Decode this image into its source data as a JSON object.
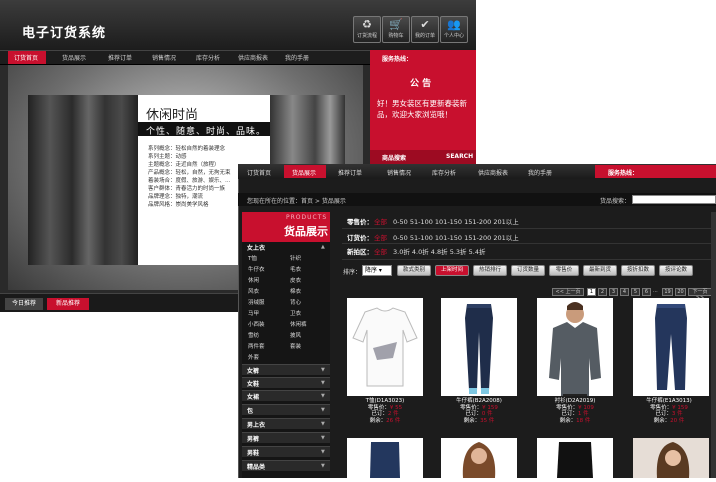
{
  "back": {
    "title": "电子订货系统",
    "top_icons": [
      {
        "icon": "recycle-icon",
        "label": "订货流程",
        "glyph": "♻"
      },
      {
        "icon": "cart-icon",
        "label": "购物车",
        "glyph": "🛒"
      },
      {
        "icon": "check-icon",
        "label": "我的订单",
        "glyph": "✔"
      },
      {
        "icon": "users-icon",
        "label": "个人中心",
        "glyph": "👥"
      }
    ],
    "nav": [
      "订货首页",
      "货品展示",
      "推荐订单",
      "销售情况",
      "库存分析",
      "供应商报表",
      "我的手册"
    ],
    "banner": {
      "heading": "休闲时尚",
      "tagline": "个性、随意、时尚、品味。",
      "specs": [
        "系列概念：轻松自然的着装理念",
        "系列主题：动感",
        "主题概念：走近自然（旅程）",
        "产品概念：轻松，自然，无拘无束",
        "着装场合：度假、旅游、娱乐、…",
        "客户群体：青春活力的时尚一族",
        "品牌理念：独特，潮流",
        "品牌风格：崇尚美学风格"
      ]
    },
    "notice": {
      "hotline": "服务热线：",
      "title": "公 告",
      "body": "好！男女装区有更新春装新品，欢迎大家浏览哦！",
      "bottom_left": "商品搜索",
      "bottom_right": "SEARCH"
    },
    "footer_tabs": [
      "今日推荐",
      "新品推荐"
    ]
  },
  "front": {
    "nav": [
      "订货首页",
      "货品展示",
      "推荐订单",
      "销售情况",
      "库存分析",
      "供应商报表",
      "我的手册"
    ],
    "hotline": "服务热线：",
    "breadcrumb": "您现在所在的位置：首页 > 货品展示",
    "search_label": "货品搜索：",
    "sidebar": {
      "title_en": "PRODUCTS",
      "title_cn": "货品展示",
      "women": "女上衣",
      "women_subs": [
        "T恤",
        "针织",
        "牛仔衣",
        "毛衣",
        "休闲",
        "皮衣",
        "风衣",
        "棉衣",
        "羽绒服",
        "背心",
        "马甲",
        "卫衣",
        "小西装",
        "休闲裤",
        "雪纺",
        "披风",
        "两件套",
        "套装",
        "外套"
      ],
      "categories": [
        "女裤",
        "女鞋",
        "女裙",
        "包",
        "男上衣",
        "男裤",
        "男鞋",
        "精品类"
      ]
    },
    "filters": [
      {
        "label": "零售价：",
        "all": "全部",
        "values": "0-50  51-100  101-150  151-200  201以上"
      },
      {
        "label": "订货价：",
        "all": "全部",
        "values": "0-50  51-100  101-150  151-200  201以上"
      },
      {
        "label": "新拍区：",
        "all": "全部",
        "values": "3.0折  4.0折  4.8折  5.3折  5.4折"
      }
    ],
    "sort_label": "排序：",
    "sort_value": "降序",
    "sort_buttons": [
      "款式类别",
      "上架时间",
      "热销排行",
      "订货数量",
      "零售价",
      "最新到货",
      "按折扣数",
      "按评论数"
    ],
    "pagination": [
      "<< 上一页",
      "1",
      "2",
      "3",
      "4",
      "5",
      "6",
      "...",
      "19",
      "20",
      "下一页 >>"
    ],
    "products": [
      {
        "name": "T恤(D1A3023)",
        "retail_label": "零售价：",
        "retail": "¥ 55",
        "ordered_label": "已订：",
        "ordered": "2 件",
        "stock_label": "剩余：",
        "stock": "26 件"
      },
      {
        "name": "牛仔裤(B2A2008)",
        "retail_label": "零售价：",
        "retail": "¥ 159",
        "ordered_label": "已订：",
        "ordered": "0 件",
        "stock_label": "剩余：",
        "stock": "35 件"
      },
      {
        "name": "衬衫(D2A2019)",
        "retail_label": "零售价：",
        "retail": "¥ 109",
        "ordered_label": "已订：",
        "ordered": "1 件",
        "stock_label": "剩余：",
        "stock": "18 件"
      },
      {
        "name": "牛仔裤(E1A3013)",
        "retail_label": "零售价：",
        "retail": "¥ 159",
        "ordered_label": "已订：",
        "ordered": "3 件",
        "stock_label": "剩余：",
        "stock": "20 件"
      }
    ]
  }
}
